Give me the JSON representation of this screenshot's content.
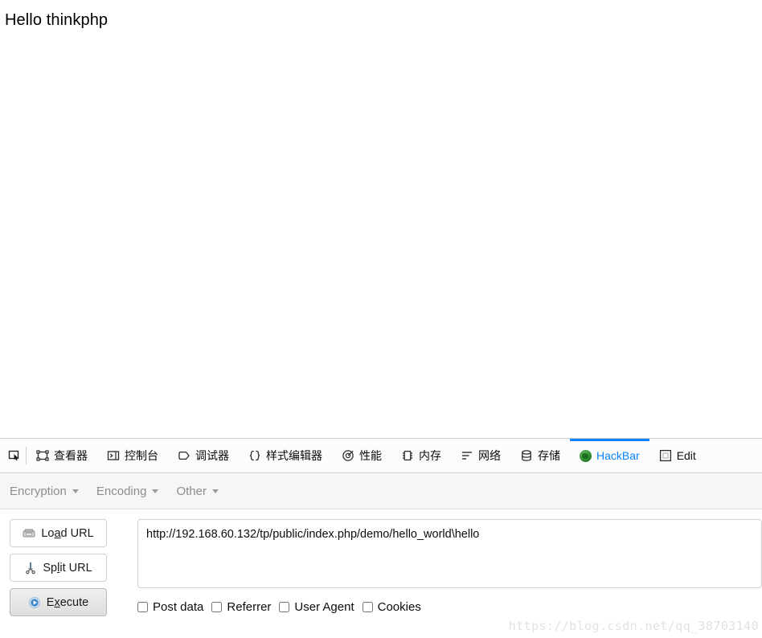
{
  "page": {
    "heading": "Hello thinkphp"
  },
  "devtools": {
    "picker_icon": "element-picker-icon",
    "tabs": [
      {
        "label": "查看器",
        "icon": "inspector-icon",
        "active": false
      },
      {
        "label": "控制台",
        "icon": "console-icon",
        "active": false
      },
      {
        "label": "调试器",
        "icon": "debugger-icon",
        "active": false
      },
      {
        "label": "样式编辑器",
        "icon": "style-editor-icon",
        "active": false
      },
      {
        "label": "性能",
        "icon": "performance-icon",
        "active": false
      },
      {
        "label": "内存",
        "icon": "memory-icon",
        "active": false
      },
      {
        "label": "网络",
        "icon": "network-icon",
        "active": false
      },
      {
        "label": "存储",
        "icon": "storage-icon",
        "active": false
      },
      {
        "label": "HackBar",
        "icon": "hackbar-globe-icon",
        "active": true
      },
      {
        "label": "Edit",
        "icon": "editor-icon",
        "active": false
      }
    ],
    "accent_color": "#0a84ff"
  },
  "hackbar": {
    "menus": [
      {
        "label": "Encryption"
      },
      {
        "label": "Encoding"
      },
      {
        "label": "Other"
      }
    ],
    "buttons": [
      {
        "id": "load-url",
        "pre": "Lo",
        "accel": "a",
        "post": "d URL",
        "icon": "load-url-icon",
        "pressed": false
      },
      {
        "id": "split-url",
        "pre": "Sp",
        "accel": "l",
        "post": "it URL",
        "icon": "split-url-icon",
        "pressed": false
      },
      {
        "id": "execute",
        "pre": "E",
        "accel": "x",
        "post": "ecute",
        "icon": "execute-icon",
        "pressed": true
      }
    ],
    "url": {
      "value": "http://192.168.60.132/tp/public/index.php/demo/hello_world\\hello",
      "placeholder": ""
    },
    "checkboxes": [
      {
        "label": "Post data",
        "checked": false
      },
      {
        "label": "Referrer",
        "checked": false
      },
      {
        "label": "User Agent",
        "checked": false
      },
      {
        "label": "Cookies",
        "checked": false
      }
    ]
  },
  "watermark": {
    "text": "https://blog.csdn.net/qq_38703140"
  }
}
